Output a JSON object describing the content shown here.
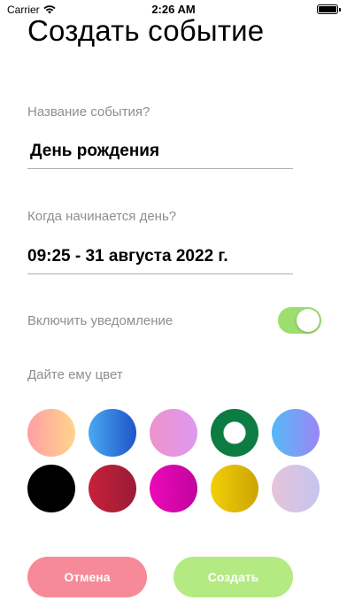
{
  "status": {
    "carrier": "Carrier",
    "time": "2:26 AM",
    "battery_level": 1.0
  },
  "title": "Создать событие",
  "event_name": {
    "label": "Название события?",
    "value": "День рождения"
  },
  "start": {
    "label": "Когда начинается день?",
    "value": "09:25 - 31 августа 2022 г."
  },
  "notification": {
    "label": "Включить уведомление",
    "enabled": true
  },
  "color": {
    "label": "Дайте ему цвет",
    "selected_index": 3,
    "swatches": [
      {
        "name": "peach",
        "from": "#ff9ea5",
        "to": "#ffd58a"
      },
      {
        "name": "blue",
        "from": "#4aa8f2",
        "to": "#1e55c8"
      },
      {
        "name": "pink-violet",
        "from": "#ee93cc",
        "to": "#dd98f0"
      },
      {
        "name": "green",
        "from": "#0d7c42",
        "to": "#0d7c42"
      },
      {
        "name": "sky-violet",
        "from": "#54b9f6",
        "to": "#9b86f3"
      },
      {
        "name": "black",
        "from": "#000000",
        "to": "#000000"
      },
      {
        "name": "crimson",
        "from": "#c8203a",
        "to": "#9a1c36"
      },
      {
        "name": "magenta",
        "from": "#ec09b8",
        "to": "#c0059d"
      },
      {
        "name": "gold",
        "from": "#f2cf06",
        "to": "#cca405"
      },
      {
        "name": "lavender",
        "from": "#e5c4da",
        "to": "#c5c4ee"
      }
    ]
  },
  "buttons": {
    "cancel": "Отмена",
    "create": "Создать"
  },
  "colors": {
    "toggle_on": "#9ddf6e",
    "cancel": "#f68a98",
    "create": "#b4ea82"
  }
}
